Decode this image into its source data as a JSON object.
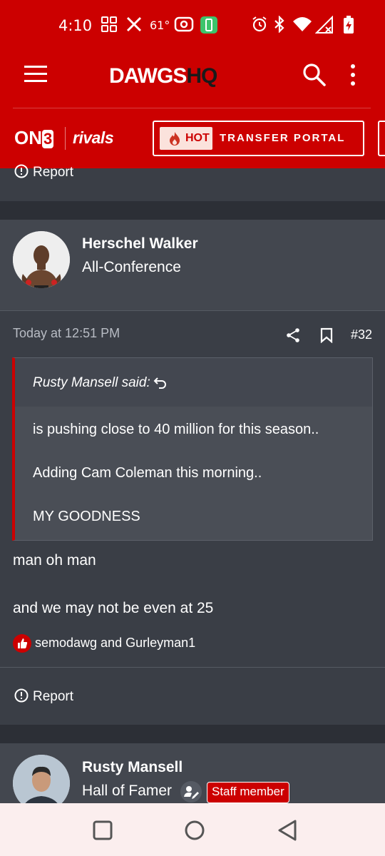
{
  "status_bar": {
    "time": "4:10",
    "temperature": "61°",
    "icons": [
      "grid-icon",
      "x-icon",
      "radio-icon",
      "battery-saver-icon",
      "alarm-icon",
      "bluetooth-icon",
      "wifi-icon",
      "signal-icon",
      "battery-charging-icon"
    ]
  },
  "header": {
    "brand_main": "DAWGS",
    "brand_accent": "HQ",
    "menu_icon": "hamburger-icon",
    "search_icon": "search-icon",
    "more_icon": "more-vertical-icon"
  },
  "sub_nav": {
    "on3_text": "ON",
    "on3_digit": "3",
    "rivals": "rivals",
    "hot_label": "HOT",
    "portal_label": "TRANSFER PORTAL"
  },
  "colors": {
    "brand_red": "#cc0000",
    "page_bg": "#3a3e46",
    "card_bg": "#43474f"
  },
  "posts": [
    {
      "report_label": "Report"
    },
    {
      "username": "Herschel Walker",
      "user_title": "All-Conference",
      "timestamp": "Today at 12:51 PM",
      "post_number": "#32",
      "quote": {
        "author": "Rusty Mansell said:",
        "lines": [
          "is pushing close to 40 million for this season..",
          "Adding Cam Coleman this morning..",
          "MY GOODNESS"
        ]
      },
      "body": [
        "man oh man",
        "and we may not be even at 25"
      ],
      "likes": "semodawg and Gurleyman1",
      "report_label": "Report"
    },
    {
      "username": "Rusty Mansell",
      "user_title": "Hall of Famer",
      "badge": "Staff member"
    }
  ]
}
